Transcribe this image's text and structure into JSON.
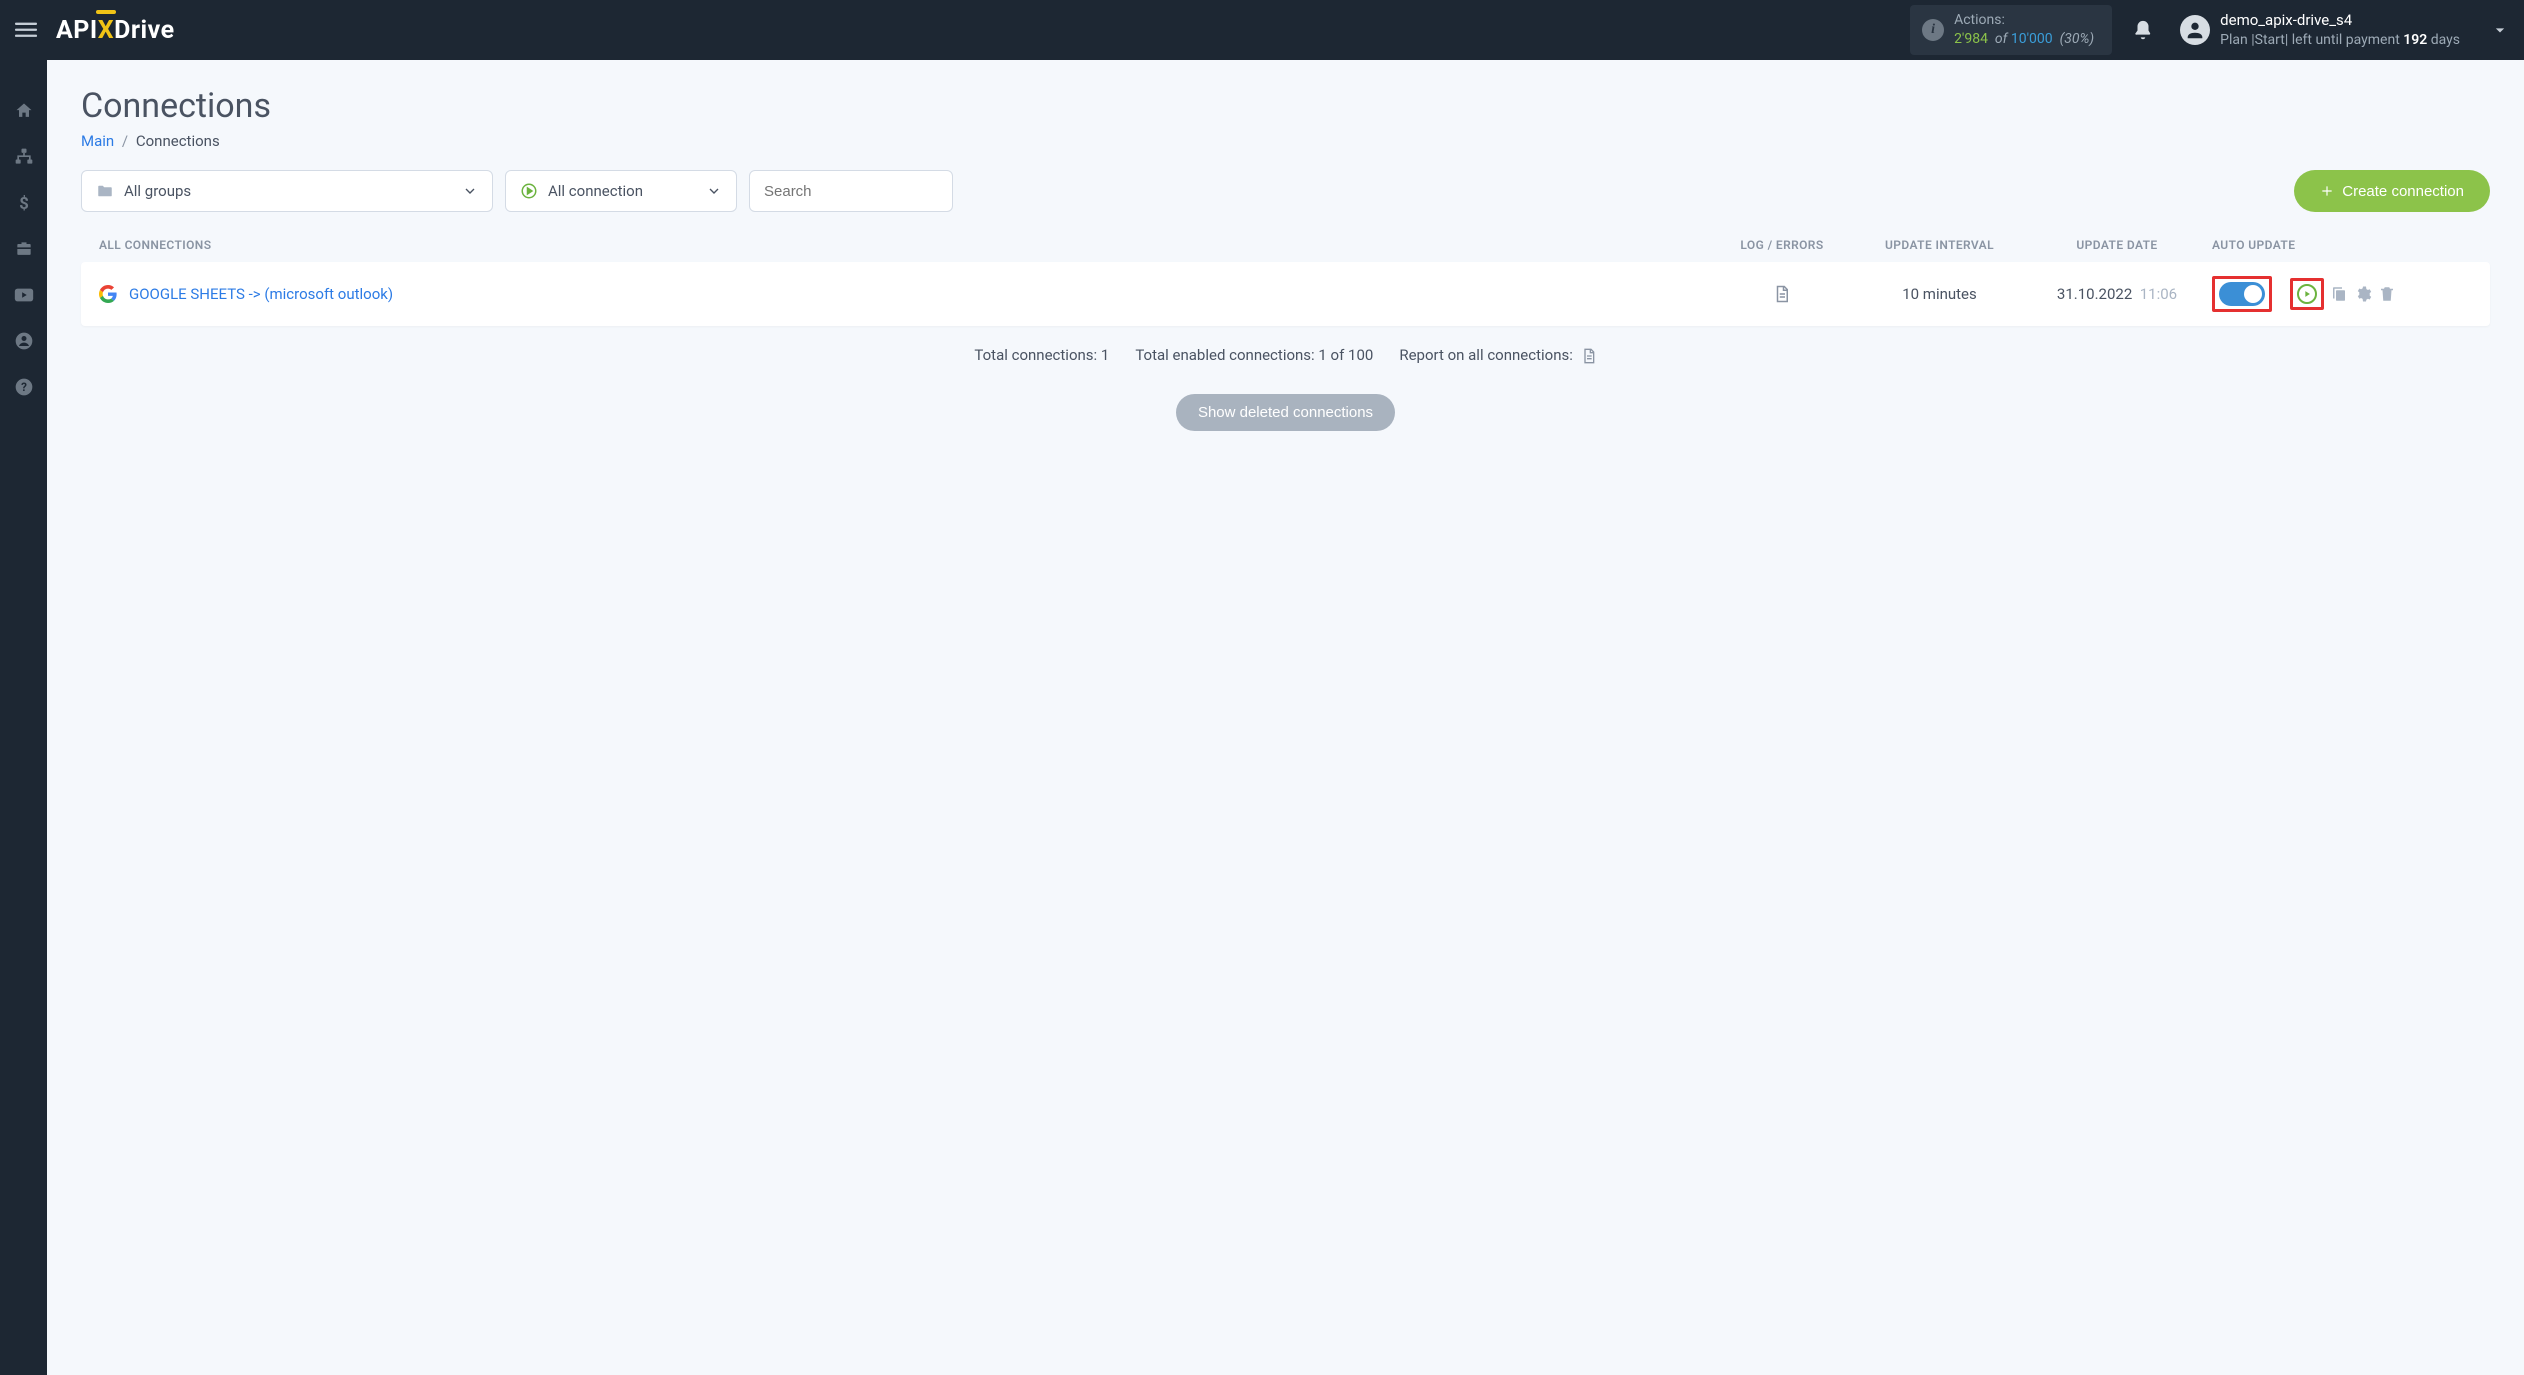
{
  "logo": {
    "part1": "API",
    "part2": "X",
    "part3": "Drive"
  },
  "header": {
    "actions_label": "Actions:",
    "actions_used": "2'984",
    "actions_of": "of",
    "actions_total": "10'000",
    "actions_pct": "(30%)",
    "user_name": "demo_apix-drive_s4",
    "plan_prefix": "Plan |Start| left until payment ",
    "plan_days": "192",
    "plan_suffix": " days"
  },
  "page": {
    "title": "Connections",
    "breadcrumb_main": "Main",
    "breadcrumb_sep": "/",
    "breadcrumb_current": "Connections"
  },
  "filters": {
    "groups_label": "All groups",
    "status_label": "All connection",
    "search_placeholder": "Search",
    "create_label": "Create connection"
  },
  "table": {
    "head_all": "ALL CONNECTIONS",
    "head_log": "LOG / ERRORS",
    "head_interval": "UPDATE INTERVAL",
    "head_date": "UPDATE DATE",
    "head_auto": "AUTO UPDATE",
    "row": {
      "name": "GOOGLE SHEETS -> (microsoft outlook)",
      "interval": "10 minutes",
      "date": "31.10.2022",
      "time": "11:06"
    }
  },
  "totals": {
    "total_conn": "Total connections: 1",
    "total_enabled": "Total enabled connections: 1 of 100",
    "report_label": "Report on all connections:",
    "show_deleted": "Show deleted connections"
  }
}
